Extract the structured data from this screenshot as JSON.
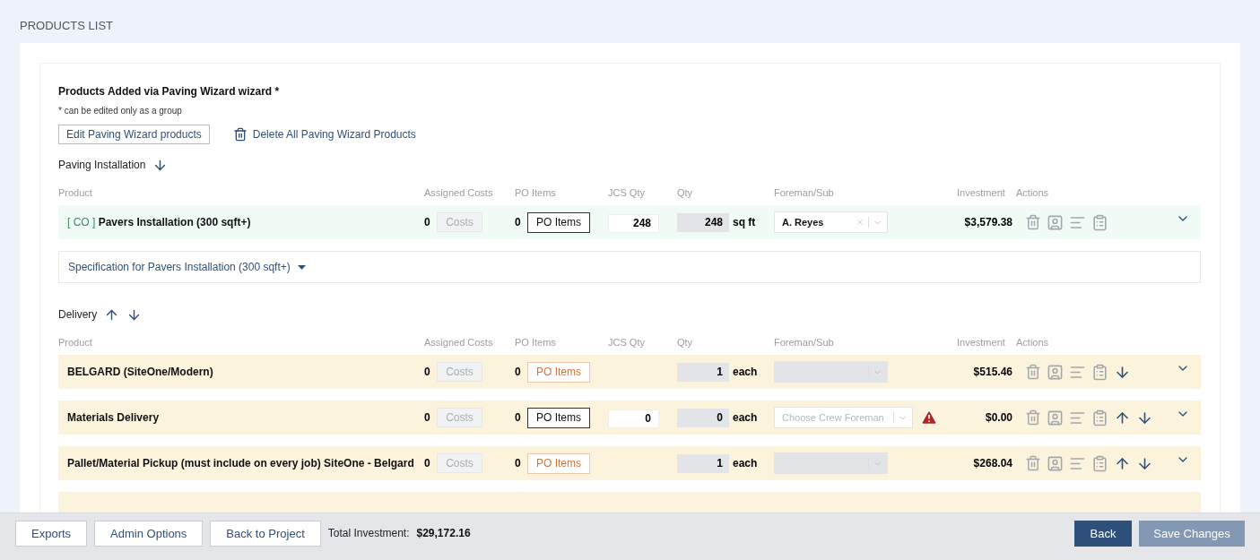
{
  "page_title": "PRODUCTS LIST",
  "wizard": {
    "title": "Products Added via Paving Wizard wizard *",
    "note": "* can be edited only as a group",
    "edit_button": "Edit Paving Wizard products",
    "delete_link": "Delete All Paving Wizard Products"
  },
  "sections": [
    {
      "title": "Paving Installation",
      "move_up": false,
      "move_down": true,
      "columns": [
        "Product",
        "Assigned Costs",
        "PO Items",
        "JCS Qty",
        "Qty",
        "Foreman/Sub",
        "Investment",
        "Actions"
      ],
      "rows": [
        {
          "color": "#effbf4",
          "tag": "[ CO ]",
          "name": "Pavers Installation (300 sqft+)",
          "costs_count": "0",
          "costs_label": "Costs",
          "po_count": "0",
          "po_label": "PO Items",
          "po_alert": false,
          "jcs_qty": "248",
          "qty": "248",
          "unit": "sq ft",
          "foreman": {
            "value": "A. Reyes",
            "disabled": false,
            "clearable": true
          },
          "warning": false,
          "investment": "$3,579.38",
          "move_up": false,
          "move_down": false
        }
      ],
      "specification": "Specification for Pavers Installation (300 sqft+)"
    },
    {
      "title": "Delivery",
      "move_up": true,
      "move_down": true,
      "columns": [
        "Product",
        "Assigned Costs",
        "PO Items",
        "JCS Qty",
        "Qty",
        "Foreman/Sub",
        "Investment",
        "Actions"
      ],
      "rows": [
        {
          "color": "#fcf3dc",
          "name": "BELGARD (SiteOne/Modern)",
          "costs_count": "0",
          "costs_label": "Costs",
          "po_count": "0",
          "po_label": "PO Items",
          "po_alert": true,
          "qty": "1",
          "unit": "each",
          "foreman": {
            "disabled": true,
            "clearable": false
          },
          "warning": false,
          "investment": "$515.46",
          "move_up": false,
          "move_down": true
        },
        {
          "color": "#fcf3dc",
          "name": "Materials Delivery",
          "costs_count": "0",
          "costs_label": "Costs",
          "po_count": "0",
          "po_label": "PO Items",
          "po_alert": false,
          "jcs_qty": "0",
          "qty": "0",
          "unit": "each",
          "foreman": {
            "placeholder": "Choose Crew Foreman",
            "disabled": false,
            "clearable": false
          },
          "warning": true,
          "investment": "$0.00",
          "move_up": true,
          "move_down": true
        },
        {
          "color": "#fcf3dc",
          "name": "Pallet/Material Pickup (must include on every job) SiteOne - Belgard",
          "costs_count": "0",
          "costs_label": "Costs",
          "po_count": "0",
          "po_label": "PO Items",
          "po_alert": true,
          "qty": "1",
          "unit": "each",
          "foreman": {
            "disabled": true,
            "clearable": false
          },
          "warning": false,
          "investment": "$268.04",
          "move_up": true,
          "move_down": true
        },
        {
          "kind": "partial",
          "color": "#fcf3dc"
        }
      ]
    }
  ],
  "footer": {
    "buttons": [
      "Exports",
      "Admin Options",
      "Back to Project"
    ],
    "total_label": "Total Investment:",
    "total_value": "$29,172.16",
    "back": "Back",
    "save": {
      "label": "Save Changes",
      "disabled": true
    }
  }
}
